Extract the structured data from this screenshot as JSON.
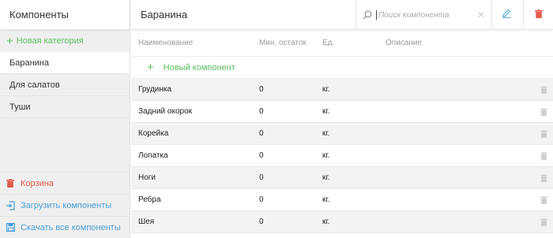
{
  "sidebar": {
    "title": "Компоненты",
    "new_category": "Новая категория",
    "categories": [
      {
        "label": "Баранина"
      },
      {
        "label": "Для салатов"
      },
      {
        "label": "Туши"
      }
    ],
    "trash": "Корзина",
    "upload": "Загрузить компоненты",
    "download": "Скачать все компоненты"
  },
  "header": {
    "title": "Баранина",
    "search_placeholder": "Поиск компонента"
  },
  "table": {
    "columns": {
      "name": "Наименование",
      "min_stock": "Мин. остаток",
      "unit": "Ед.",
      "description": "Описание"
    },
    "new_component": "Новый компонент",
    "rows": [
      {
        "name": "Грудинка",
        "min": "0",
        "unit": "кг.",
        "desc": ""
      },
      {
        "name": "Задний окорок",
        "min": "0",
        "unit": "кг.",
        "desc": ""
      },
      {
        "name": "Корейка",
        "min": "0",
        "unit": "кг.",
        "desc": ""
      },
      {
        "name": "Лопатка",
        "min": "0",
        "unit": "кг.",
        "desc": ""
      },
      {
        "name": "Ноги",
        "min": "0",
        "unit": "кг.",
        "desc": ""
      },
      {
        "name": "Ребра",
        "min": "0",
        "unit": "кг.",
        "desc": ""
      },
      {
        "name": "Шея",
        "min": "0",
        "unit": "кг.",
        "desc": ""
      }
    ]
  },
  "colors": {
    "green": "#5cbf61",
    "red": "#e35a4d",
    "blue": "#4a9fd8"
  }
}
